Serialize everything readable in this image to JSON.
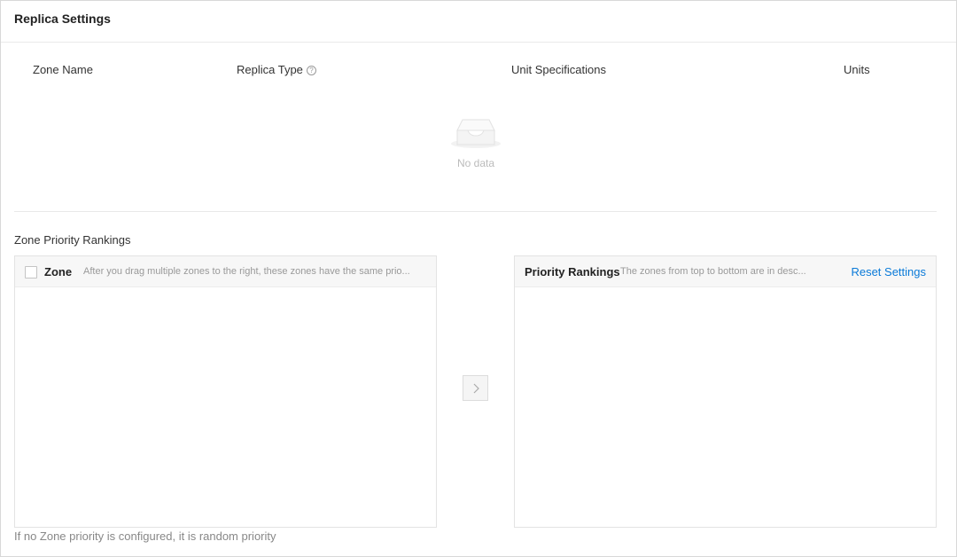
{
  "header": {
    "title": "Replica Settings"
  },
  "table": {
    "columns": [
      "Zone Name",
      "Replica Type",
      "Unit Specifications",
      "Units"
    ],
    "help_icon": "question-circle-icon",
    "empty_icon": "empty-inbox-icon",
    "empty_text": "No data"
  },
  "zone_priority": {
    "title": "Zone Priority Rankings",
    "left": {
      "label": "Zone",
      "hint": "After you drag multiple zones to the right, these zones have the same prio..."
    },
    "move_icon": "chevron-right-icon",
    "right": {
      "label": "Priority Rankings",
      "hint": "The zones from top to bottom are in desc...",
      "reset_label": "Reset Settings"
    },
    "footer_note": "If no Zone priority is configured, it is random priority"
  },
  "colors": {
    "link": "#0a7ad8",
    "border": "#e3e3e3",
    "muted": "#999999"
  }
}
